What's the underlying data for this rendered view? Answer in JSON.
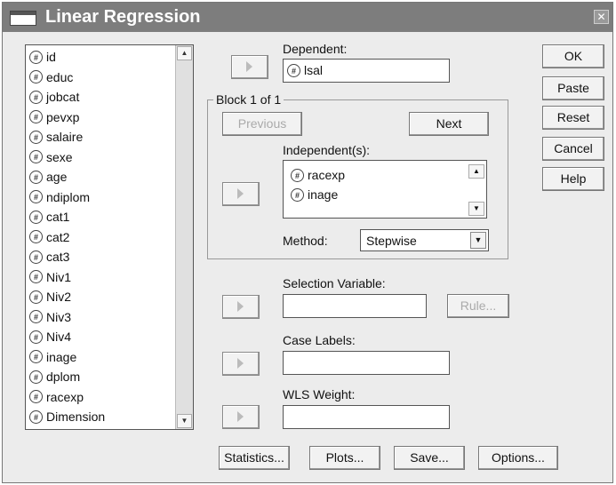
{
  "window": {
    "title": "Linear Regression",
    "close_glyph": "✕"
  },
  "variables": [
    "id",
    "educ",
    "jobcat",
    "pevxp",
    "salaire",
    "sexe",
    "age",
    "ndiplom",
    "cat1",
    "cat2",
    "cat3",
    "Niv1",
    "Niv2",
    "Niv3",
    "Niv4",
    "inage",
    "dplom",
    "racexp",
    "Dimension"
  ],
  "variable_icon": "scale-variable-icon",
  "dependent": {
    "label": "Dependent:",
    "value": "lsal"
  },
  "block": {
    "label": "Block 1 of 1",
    "previous": "Previous",
    "next": "Next"
  },
  "independents": {
    "label": "Independent(s):",
    "items": [
      "racexp",
      "inage"
    ]
  },
  "method": {
    "label": "Method:",
    "value": "Stepwise"
  },
  "selection": {
    "label": "Selection Variable:",
    "rule": "Rule..."
  },
  "case_labels": {
    "label": "Case Labels:"
  },
  "wls": {
    "label": "WLS Weight:"
  },
  "side_buttons": [
    "OK",
    "Paste",
    "Reset",
    "Cancel",
    "Help"
  ],
  "bottom_buttons": [
    "Statistics...",
    "Plots...",
    "Save...",
    "Options..."
  ]
}
